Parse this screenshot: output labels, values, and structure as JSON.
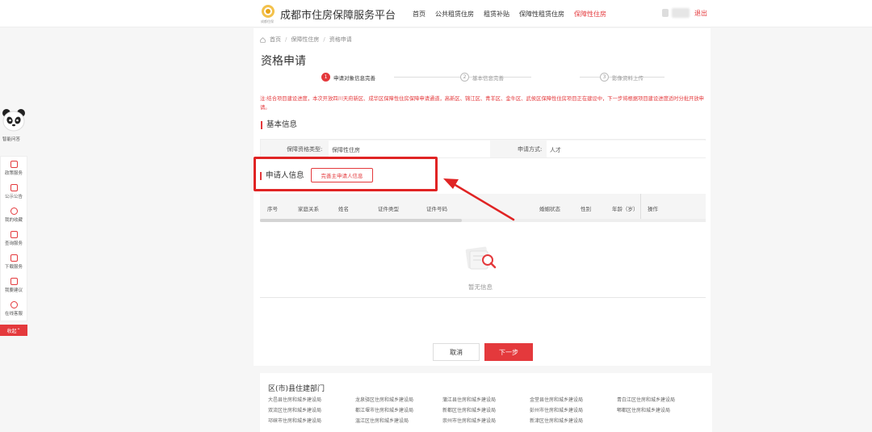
{
  "header": {
    "logo_text": "成都住保",
    "site_title": "成都市住房保障服务平台",
    "nav": [
      {
        "label": "首页",
        "active": false
      },
      {
        "label": "公共租赁住房",
        "active": false
      },
      {
        "label": "租赁补贴",
        "active": false
      },
      {
        "label": "保障性租赁住房",
        "active": false
      },
      {
        "label": "保障性住房",
        "active": true
      }
    ],
    "logout": "退出"
  },
  "breadcrumb": {
    "home": "首页",
    "level1": "保障性住房",
    "level2": "资格申请"
  },
  "page_title": "资格申请",
  "steps": [
    {
      "num": "1",
      "label": "申请对象信息完善",
      "active": true
    },
    {
      "num": "2",
      "label": "基本信息完善",
      "active": false
    },
    {
      "num": "3",
      "label": "影像资料上传",
      "active": false
    }
  ],
  "notice": "注:结合项目建设进度，本次开放四川天府新区、成华区保障性住房保障申请通道，高新区、锦江区、青羊区、金牛区、武侯区保障性住房项目正在建设中，下一步将根据项目建设进度适时分批开放申请。",
  "basic_info": {
    "title": "基本信息",
    "type_label": "保障资格类型:",
    "type_value": "保障性住房",
    "method_label": "申请方式:",
    "method_value": "人才"
  },
  "applicant": {
    "title": "申请人信息",
    "add_button": "完善主申请人信息",
    "columns": [
      "序号",
      "家庭关系",
      "姓名",
      "证件类型",
      "证件号码",
      "婚姻状态",
      "性别",
      "年龄（岁）",
      "操作"
    ],
    "empty_text": "暂无信息"
  },
  "buttons": {
    "cancel": "取消",
    "next": "下一步"
  },
  "footer": {
    "title": "区(市)县住建部门",
    "links": [
      "大邑县住房和城乡建设局",
      "龙泉驿区住房和城乡建设局",
      "蒲江县住房和城乡建设局",
      "金堂县住房和城乡建设局",
      "青白江区住房和城乡建设局",
      "双流区住房和城乡建设局",
      "都江堰市住房和城乡建设局",
      "新都区住房和城乡建设局",
      "彭州市住房和城乡建设局",
      "郫都区住房和城乡建设局",
      "邛崃市住房和城乡建设局",
      "温江区住房和城乡建设局",
      "崇州市住房和城乡建设局",
      "新津区住房和城乡建设局"
    ]
  },
  "sidebar": {
    "assistant": "智能问答",
    "items": [
      {
        "label": "政策服务",
        "icon": "document-icon"
      },
      {
        "label": "公示公告",
        "icon": "briefcase-icon"
      },
      {
        "label": "我的收藏",
        "icon": "star-icon"
      },
      {
        "label": "查询服务",
        "icon": "search-doc-icon"
      },
      {
        "label": "下载服务",
        "icon": "download-icon"
      },
      {
        "label": "我要建议",
        "icon": "mail-icon"
      },
      {
        "label": "在线客服",
        "icon": "headset-icon"
      }
    ],
    "collapse": "收起"
  },
  "colors": {
    "accent": "#e4393c",
    "annotation": "#e02424"
  }
}
